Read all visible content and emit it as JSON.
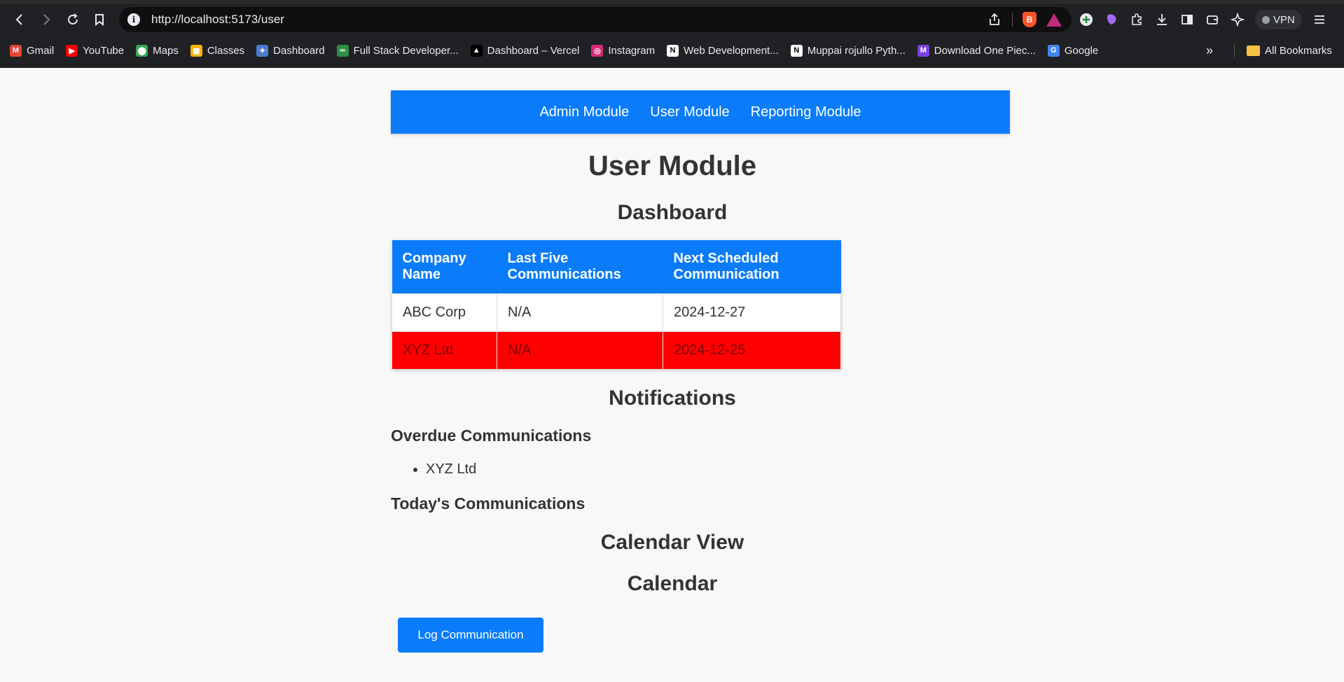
{
  "browser": {
    "url": "http://localhost:5173/user",
    "vpn_label": "VPN",
    "bookmarks": [
      {
        "label": "Gmail",
        "icon": "gmail-icon",
        "color": "#ea4335",
        "glyph": "M"
      },
      {
        "label": "YouTube",
        "icon": "youtube-icon",
        "color": "#ff0000",
        "glyph": "▶"
      },
      {
        "label": "Maps",
        "icon": "maps-icon",
        "color": "#34a853",
        "glyph": "⬤"
      },
      {
        "label": "Classes",
        "icon": "classes-icon",
        "color": "#f4b400",
        "glyph": "▦"
      },
      {
        "label": "Dashboard",
        "icon": "dashboard-icon",
        "color": "#4a7bd0",
        "glyph": "✦"
      },
      {
        "label": "Full Stack Developer...",
        "icon": "geeksforgeeks-icon",
        "color": "#2f8d46",
        "glyph": "∞"
      },
      {
        "label": "Dashboard – Vercel",
        "icon": "vercel-icon",
        "color": "#000000",
        "glyph": "▲"
      },
      {
        "label": "Instagram",
        "icon": "instagram-icon",
        "color": "#d62976",
        "glyph": "◎"
      },
      {
        "label": "Web Development...",
        "icon": "notion-icon",
        "color": "#ffffff",
        "glyph": "N"
      },
      {
        "label": "Muppai rojullo Pyth...",
        "icon": "notion-icon",
        "color": "#ffffff",
        "glyph": "N"
      },
      {
        "label": "Download One Piec...",
        "icon": "m-site-icon",
        "color": "#7b3fe4",
        "glyph": "M"
      },
      {
        "label": "Google",
        "icon": "google-icon",
        "color": "#4285f4",
        "glyph": "G"
      }
    ],
    "all_bookmarks_label": "All Bookmarks"
  },
  "nav": {
    "items": [
      "Admin Module",
      "User Module",
      "Reporting Module"
    ]
  },
  "page": {
    "title": "User Module",
    "dashboard_heading": "Dashboard",
    "table": {
      "headers": [
        "Company Name",
        "Last Five Communications",
        "Next Scheduled Communication"
      ],
      "rows": [
        {
          "company": "ABC Corp",
          "last_five": "N/A",
          "next": "2024-12-27",
          "overdue": false
        },
        {
          "company": "XYZ Ltd",
          "last_five": "N/A",
          "next": "2024-12-25",
          "overdue": true
        }
      ]
    },
    "notifications_heading": "Notifications",
    "overdue_heading": "Overdue Communications",
    "overdue_items": [
      "XYZ Ltd"
    ],
    "today_heading": "Today's Communications",
    "calendar_view_heading": "Calendar View",
    "calendar_heading": "Calendar",
    "log_button": "Log Communication"
  },
  "colors": {
    "accent": "#0a7cfb",
    "overdue": "#ff0000"
  }
}
